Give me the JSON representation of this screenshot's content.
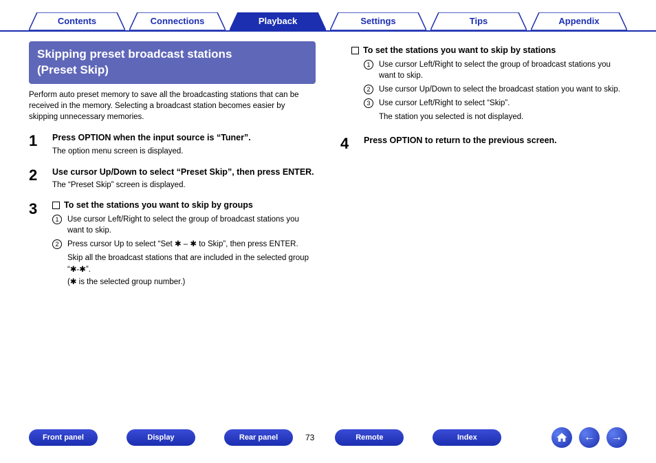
{
  "nav": {
    "tabs": [
      {
        "label": "Contents",
        "active": false
      },
      {
        "label": "Connections",
        "active": false
      },
      {
        "label": "Playback",
        "active": true
      },
      {
        "label": "Settings",
        "active": false
      },
      {
        "label": "Tips",
        "active": false
      },
      {
        "label": "Appendix",
        "active": false
      }
    ]
  },
  "header": {
    "title_line1": "Skipping preset broadcast stations",
    "title_line2": "(Preset Skip)"
  },
  "intro": "Perform auto preset memory to save all the broadcasting stations that can be received in the memory. Selecting a broadcast station becomes easier by skipping unnecessary memories.",
  "steps_left": [
    {
      "num": "1",
      "title": "Press OPTION when the input source is “Tuner”.",
      "desc": "The option menu screen is displayed."
    },
    {
      "num": "2",
      "title": "Use cursor Up/Down to select “Preset Skip”, then press ENTER.",
      "desc": "The “Preset Skip” screen is displayed."
    }
  ],
  "step3": {
    "num": "3",
    "subhead": "To set the stations you want to skip by groups",
    "items": [
      "Use cursor Left/Right to select the group of broadcast stations you want to skip.",
      "Press cursor Up to select “Set ✱ – ✱ to Skip”, then press ENTER."
    ],
    "note1": "Skip all the broadcast stations that are included in the selected group “✱-✱”.",
    "note2": "(✱ is the selected group number.)"
  },
  "right_sub": {
    "subhead": "To set the stations you want to skip by stations",
    "items": [
      "Use cursor Left/Right to select the group of broadcast stations you want to skip.",
      "Use cursor Up/Down to select the broadcast station you want to skip.",
      "Use cursor Left/Right to select “Skip”."
    ],
    "note": "The station you selected is not displayed."
  },
  "step4": {
    "num": "4",
    "title": "Press OPTION to return to the previous screen."
  },
  "footer": {
    "buttons": [
      "Front panel",
      "Display",
      "Rear panel",
      "Remote",
      "Index"
    ],
    "page": "73"
  }
}
